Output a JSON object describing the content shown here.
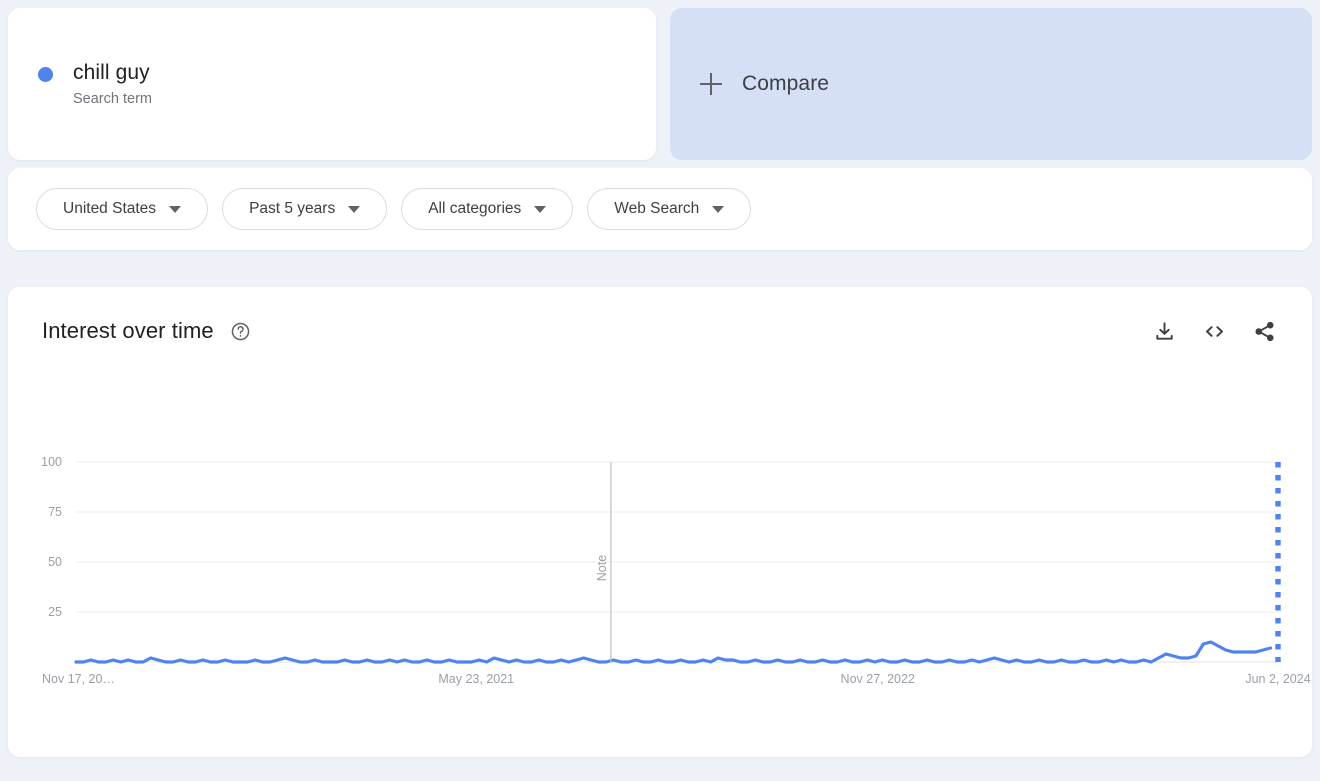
{
  "search_card": {
    "term": "chill guy",
    "subtitle": "Search term",
    "dot_color": "#5083ee"
  },
  "compare_card": {
    "label": "Compare",
    "icon": "plus-icon",
    "background": "#d5dff5"
  },
  "filters": [
    {
      "label": "United States",
      "name": "location"
    },
    {
      "label": "Past 5 years",
      "name": "time-range"
    },
    {
      "label": "All categories",
      "name": "category"
    },
    {
      "label": "Web Search",
      "name": "search-type"
    }
  ],
  "chart_panel": {
    "title": "Interest over time",
    "help_icon": "help-circle-icon",
    "actions": [
      {
        "name": "download-icon",
        "label": "Download"
      },
      {
        "name": "embed-code-icon",
        "label": "Embed"
      },
      {
        "name": "share-icon",
        "label": "Share"
      }
    ]
  },
  "chart_data": {
    "type": "line",
    "title": "Interest over time",
    "xlabel": "",
    "ylabel": "",
    "ylim": [
      0,
      100
    ],
    "yticks": [
      25,
      50,
      75,
      100
    ],
    "ytick_labels": [
      "25",
      "50",
      "75",
      "100"
    ],
    "xtick_labels": [
      "Nov 17, 20…",
      "May 23, 2021",
      "Nov 27, 2022",
      "Jun 2, 2024"
    ],
    "xtick_positions": [
      0,
      0.333,
      0.667,
      1.0
    ],
    "grid": true,
    "legend": "none",
    "line_color": "#5083ee",
    "series": [
      {
        "name": "chill guy",
        "values": [
          0,
          0,
          1,
          0,
          0,
          1,
          0,
          1,
          0,
          0,
          2,
          1,
          0,
          0,
          1,
          0,
          0,
          1,
          0,
          0,
          1,
          0,
          0,
          0,
          1,
          0,
          0,
          1,
          2,
          1,
          0,
          0,
          1,
          0,
          0,
          0,
          1,
          0,
          0,
          1,
          0,
          0,
          1,
          0,
          1,
          0,
          0,
          1,
          0,
          0,
          1,
          0,
          0,
          0,
          1,
          0,
          2,
          1,
          0,
          1,
          0,
          0,
          1,
          0,
          0,
          1,
          0,
          1,
          2,
          1,
          0,
          0,
          1,
          0,
          0,
          1,
          0,
          0,
          1,
          0,
          0,
          1,
          0,
          0,
          1,
          0,
          2,
          1,
          1,
          0,
          0,
          1,
          0,
          0,
          1,
          0,
          0,
          1,
          0,
          0,
          1,
          0,
          0,
          1,
          0,
          0,
          1,
          0,
          1,
          0,
          0,
          1,
          0,
          0,
          1,
          0,
          0,
          1,
          0,
          0,
          1,
          0,
          1,
          2,
          1,
          0,
          1,
          0,
          0,
          1,
          0,
          0,
          1,
          0,
          0,
          1,
          0,
          0,
          1,
          0,
          1,
          0,
          0,
          1,
          0,
          2,
          4,
          3,
          2,
          2,
          3,
          9,
          10,
          8,
          6,
          5,
          5,
          5,
          5,
          6,
          7,
          100
        ],
        "partial_last_point": true,
        "partial_marker": "dotted-vertical-line"
      }
    ],
    "annotations": [
      {
        "type": "vertical-note-line",
        "label": "Note",
        "x_fraction": 0.445,
        "color": "#bdc1c6"
      }
    ]
  }
}
